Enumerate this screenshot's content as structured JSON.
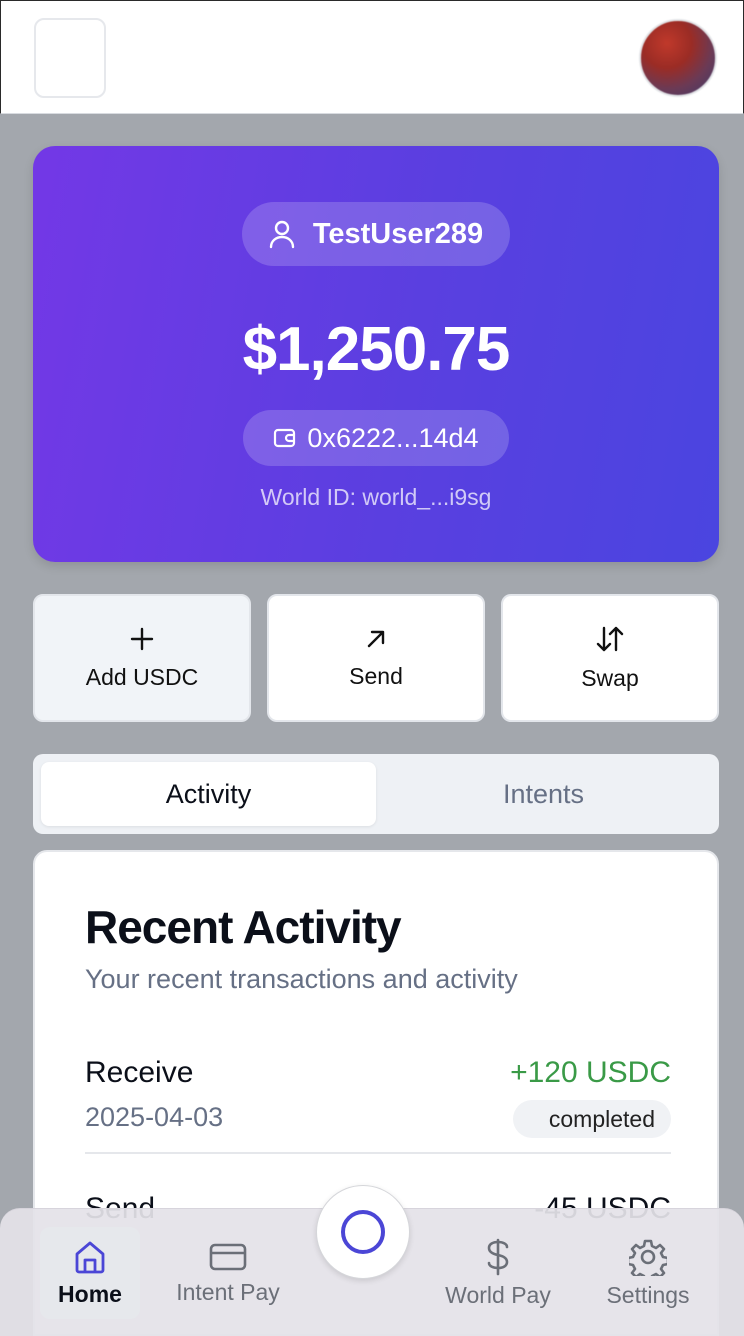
{
  "profile": {
    "username": "TestUser289"
  },
  "wallet": {
    "balance": "$1,250.75",
    "address": "0x6222...14d4",
    "world_id": "World ID: world_...i9sg"
  },
  "actions": [
    {
      "label": "Add USDC",
      "icon": "plus-icon"
    },
    {
      "label": "Send",
      "icon": "arrow-up-right-icon"
    },
    {
      "label": "Swap",
      "icon": "swap-arrows-icon"
    }
  ],
  "tabs": [
    {
      "label": "Activity",
      "active": true
    },
    {
      "label": "Intents",
      "active": false
    }
  ],
  "activity": {
    "title": "Recent Activity",
    "subtitle": "Your recent transactions and activity",
    "transactions": [
      {
        "type": "Receive",
        "date": "2025-04-03",
        "amount": "+120 USDC",
        "status": "completed"
      },
      {
        "type": "Send",
        "date": "",
        "amount": "-45 USDC",
        "status": ""
      }
    ]
  },
  "nav": [
    {
      "label": "Home",
      "icon": "home-icon",
      "active": true
    },
    {
      "label": "Intent Pay",
      "icon": "card-icon",
      "active": false
    },
    {
      "label": "World Pay",
      "icon": "dollar-icon",
      "active": false
    },
    {
      "label": "Settings",
      "icon": "gear-icon",
      "active": false
    }
  ],
  "colors": {
    "accent": "#4b46d6",
    "card_gradient_start": "#7338e6",
    "card_gradient_end": "#4a45e0",
    "positive": "#3a9a47"
  }
}
